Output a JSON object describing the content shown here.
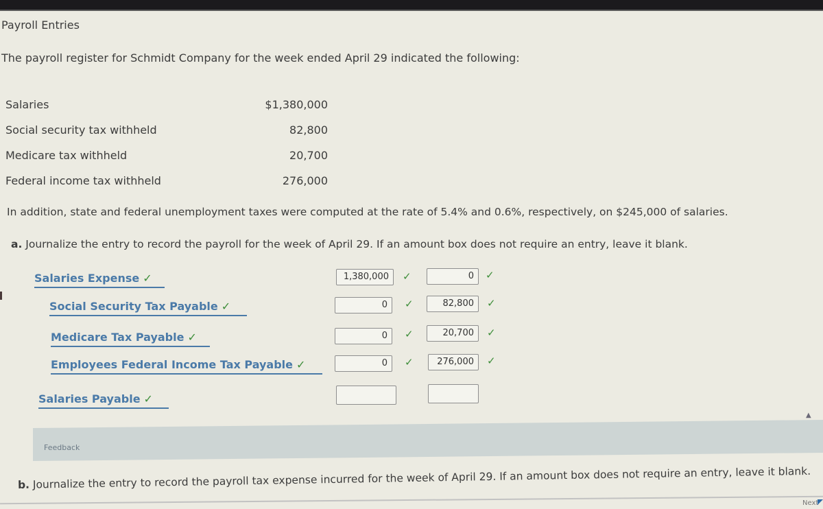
{
  "page_title": "Payroll Entries",
  "intro": "The payroll register for Schmidt Company for the week ended April 29 indicated the following:",
  "register": [
    {
      "label": "Salaries",
      "amount": "$1,380,000"
    },
    {
      "label": "Social security tax withheld",
      "amount": "82,800"
    },
    {
      "label": "Medicare tax withheld",
      "amount": "20,700"
    },
    {
      "label": "Federal income tax withheld",
      "amount": "276,000"
    }
  ],
  "additional_info": "In addition, state and federal unemployment taxes were computed at the rate of 5.4% and 0.6%, respectively, on $245,000 of salaries.",
  "part_a": {
    "letter": "a.",
    "instruction": "Journalize the entry to record the payroll for the week of April 29. If an amount box does not require an entry, leave it blank."
  },
  "journal": [
    {
      "account": "Salaries Expense",
      "debit": "1,380,000",
      "credit": "0",
      "account_check": "✓",
      "debit_check": "✓",
      "credit_check": "✓"
    },
    {
      "account": "Social Security Tax Payable",
      "debit": "0",
      "credit": "82,800",
      "account_check": "✓",
      "debit_check": "✓",
      "credit_check": "✓"
    },
    {
      "account": "Medicare Tax Payable",
      "debit": "0",
      "credit": "20,700",
      "account_check": "✓",
      "debit_check": "✓",
      "credit_check": "✓"
    },
    {
      "account": "Employees Federal Income Tax Payable",
      "debit": "0",
      "credit": "276,000",
      "account_check": "✓",
      "debit_check": "✓",
      "credit_check": "✓"
    },
    {
      "account": "Salaries Payable",
      "debit": "",
      "credit": "",
      "account_check": "✓"
    }
  ],
  "feedback_label": "Feedback",
  "collapse_icon": "▲",
  "part_b": {
    "letter": "b.",
    "instruction": "Journalize the entry to record the payroll tax expense incurred for the week of April 29. If an amount box does not require an entry, leave it blank."
  },
  "next_label": "Next"
}
